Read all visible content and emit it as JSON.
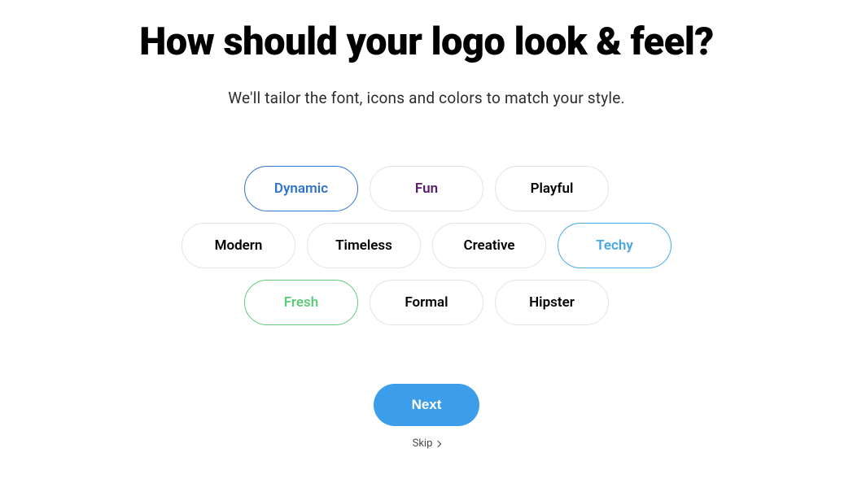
{
  "heading": "How should your logo look & feel?",
  "subheading": "We'll tailor the font, icons and colors to match your style.",
  "tags": {
    "rows": [
      [
        {
          "key": "dynamic",
          "label": "Dynamic",
          "variant": "dynamic"
        },
        {
          "key": "fun",
          "label": "Fun",
          "variant": "fun"
        },
        {
          "key": "playful",
          "label": "Playful",
          "variant": "default"
        }
      ],
      [
        {
          "key": "modern",
          "label": "Modern",
          "variant": "default"
        },
        {
          "key": "timeless",
          "label": "Timeless",
          "variant": "default"
        },
        {
          "key": "creative",
          "label": "Creative",
          "variant": "default"
        },
        {
          "key": "techy",
          "label": "Techy",
          "variant": "techy"
        }
      ],
      [
        {
          "key": "fresh",
          "label": "Fresh",
          "variant": "fresh"
        },
        {
          "key": "formal",
          "label": "Formal",
          "variant": "default"
        },
        {
          "key": "hipster",
          "label": "Hipster",
          "variant": "default"
        }
      ]
    ]
  },
  "actions": {
    "next_label": "Next",
    "skip_label": "Skip"
  },
  "colors": {
    "dynamic_border": "#2f73d1",
    "fun_text": "#5a1a6f",
    "techy_border": "#45a7e6",
    "fresh_border": "#5ecb7a",
    "next_bg": "#3c9eea"
  }
}
